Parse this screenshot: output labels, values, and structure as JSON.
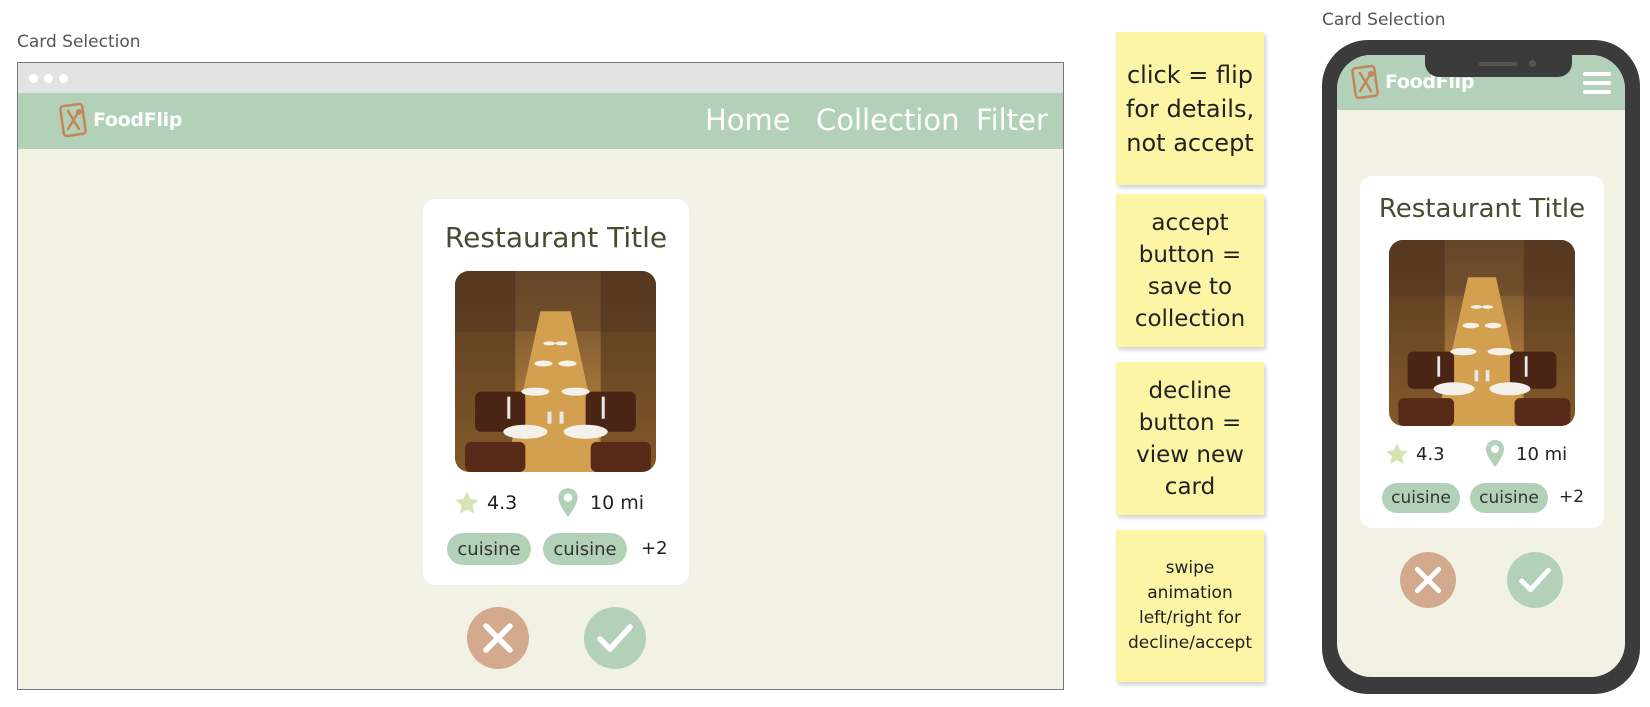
{
  "desktop": {
    "caption": "Card Selection",
    "brand": "FoodFlip",
    "nav": [
      "Home",
      "Collection",
      "Filter"
    ],
    "card": {
      "title": "Restaurant Title",
      "rating": "4.3",
      "distance": "10 mi",
      "tags": [
        "cuisine",
        "cuisine"
      ],
      "more_tags": "+2"
    }
  },
  "notes": [
    "click = flip for details, not accept",
    "accept button = save to collection",
    "decline button = view new card",
    "swipe animation left/right for decline/accept"
  ],
  "mobile": {
    "caption": "Card Selection",
    "brand": "FoodFlip",
    "card": {
      "title": "Restaurant Title",
      "rating": "4.3",
      "distance": "10 mi",
      "tags": [
        "cuisine",
        "cuisine"
      ],
      "more_tags": "+2"
    }
  },
  "colors": {
    "nav_green": "#b3d1b9",
    "background": "#f2f2e4",
    "decline": "#d3aa8e",
    "accept": "#b3d1b9",
    "sticky": "#fdf5a6",
    "star": "#d8e3b4"
  },
  "icons": [
    "foodflip-logo-icon",
    "star-icon",
    "location-pin-icon",
    "close-icon",
    "check-icon",
    "hamburger-menu-icon"
  ]
}
